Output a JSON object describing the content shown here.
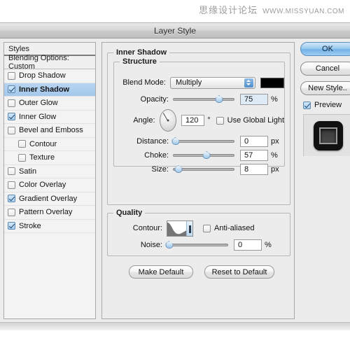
{
  "watermark": {
    "cn": "思缘设计论坛",
    "en": "WWW.MISSYUAN.COM"
  },
  "window": {
    "title": "Layer Style"
  },
  "sidebar": {
    "styles_label": "Styles",
    "blending_label": "Blending Options: Custom",
    "effects": [
      {
        "label": "Drop Shadow",
        "checked": false,
        "sub": false,
        "selected": false
      },
      {
        "label": "Inner Shadow",
        "checked": true,
        "sub": false,
        "selected": true
      },
      {
        "label": "Outer Glow",
        "checked": false,
        "sub": false,
        "selected": false
      },
      {
        "label": "Inner Glow",
        "checked": true,
        "sub": false,
        "selected": false
      },
      {
        "label": "Bevel and Emboss",
        "checked": false,
        "sub": false,
        "selected": false
      },
      {
        "label": "Contour",
        "checked": false,
        "sub": true,
        "selected": false
      },
      {
        "label": "Texture",
        "checked": false,
        "sub": true,
        "selected": false
      },
      {
        "label": "Satin",
        "checked": false,
        "sub": false,
        "selected": false
      },
      {
        "label": "Color Overlay",
        "checked": false,
        "sub": false,
        "selected": false
      },
      {
        "label": "Gradient Overlay",
        "checked": true,
        "sub": false,
        "selected": false
      },
      {
        "label": "Pattern Overlay",
        "checked": false,
        "sub": false,
        "selected": false
      },
      {
        "label": "Stroke",
        "checked": true,
        "sub": false,
        "selected": false
      }
    ]
  },
  "main": {
    "group_title": "Inner Shadow",
    "structure": {
      "legend": "Structure",
      "blend_mode_label": "Blend Mode:",
      "blend_mode_value": "Multiply",
      "shadow_color": "#000000",
      "opacity_label": "Opacity:",
      "opacity_value": "75",
      "opacity_unit": "%",
      "angle_label": "Angle:",
      "angle_value": "120",
      "angle_unit": "°",
      "use_global_light_label": "Use Global Light",
      "use_global_light_checked": false,
      "distance_label": "Distance:",
      "distance_value": "0",
      "distance_unit": "px",
      "choke_label": "Choke:",
      "choke_value": "57",
      "choke_unit": "%",
      "size_label": "Size:",
      "size_value": "8",
      "size_unit": "px"
    },
    "quality": {
      "legend": "Quality",
      "contour_label": "Contour:",
      "anti_aliased_label": "Anti-aliased",
      "anti_aliased_checked": false,
      "noise_label": "Noise:",
      "noise_value": "0",
      "noise_unit": "%"
    },
    "make_default_label": "Make Default",
    "reset_default_label": "Reset to Default"
  },
  "right": {
    "ok_label": "OK",
    "cancel_label": "Cancel",
    "new_style_label": "New Style..",
    "preview_label": "Preview",
    "preview_checked": true
  }
}
